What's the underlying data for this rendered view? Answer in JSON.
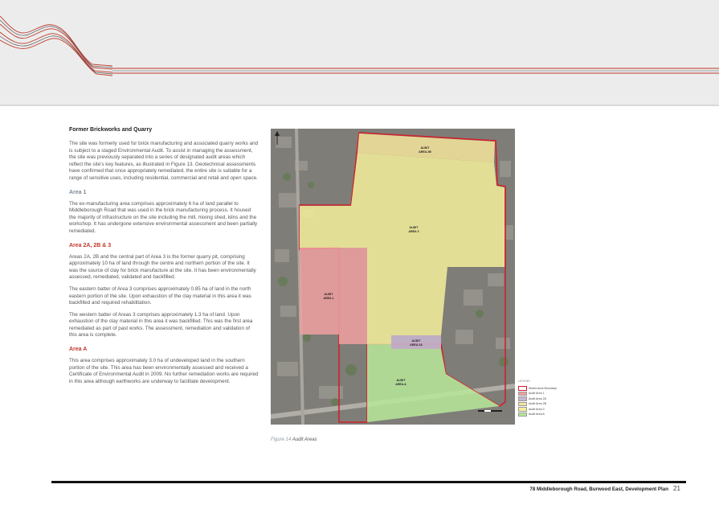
{
  "main": {
    "title": "Former Brickworks and Quarry",
    "intro": "The site was formerly used for brick manufacturing and associated quarry works and is subject to a staged Environmental Audit. To assist in managing the assessment, the site was previously separated into a series of designated audit areas which reflect the site's key features, as illustrated in Figure 13.  Geotechnical assessments have confirmed that once appropriately remediated, the entire site is suitable for a range of sensitive uses, including residential, commercial and retail and open space.",
    "area1_heading": "Area 1",
    "area1_text": "The ex-manufacturing area comprises approximately 6 ha of land parallel to Middleborough Road that was used in the brick manufacturing process.  It housed the majority of infrastructure on the site including the mill, mixing shed, kilns and the workshop. It has undergone extensive environmental assessment and been partially remediated.",
    "area2_heading": "Area 2A, 2B & 3",
    "area2_text1": "Areas 2A, 2B and the central part of Area 3 is the former quarry pit, comprising approximately 10 ha of land through the centre and northern portion of the site.  It was the source of clay for brick manufacture at the site.  It has been environmentally assessed, remediated, validated and backfilled.",
    "area2_text2": "The eastern batter of Area 3 comprises approximately 0.85 ha of land in the north eastern portion of the site. Upon exhaustion of the clay material in this area it was backfilled and required rehabilitation.",
    "area2_text3": "The western batter of Areas 3 comprises approximately 1.3 ha of land.  Upon exhaustion of the clay material in this area it was backfilled.  This was the first area remediated as part of past works.  The assessment, remediation and validation of this area is complete.",
    "areaA_heading": "Area A",
    "areaA_text": "This area comprises approximately 3.0 ha of undeveloped land in the southern portion of the site. This area has been environmentally assessed and received a Certificate of Environmental Audit in 2009.  No further remediation works are required in this area although earthworks are underway to facilitate development."
  },
  "map": {
    "labels": {
      "area2b": [
        "AUDIT",
        "AREA 2B"
      ],
      "area3": [
        "AUDIT",
        "AREA 3"
      ],
      "area1": [
        "AUDIT",
        "AREA 1"
      ],
      "area2a": [
        "AUDIT",
        "AREA 2A"
      ],
      "areaA": [
        "AUDIT",
        "AREA A"
      ]
    },
    "legend": {
      "title": "LEGEND",
      "items": [
        {
          "label": "Works Area Boundary",
          "color": "#ffffff",
          "border": "#d0202a"
        },
        {
          "label": "Audit Area 1",
          "color": "#f0a0a0",
          "border": "#999999"
        },
        {
          "label": "Audit Area 2A",
          "color": "#c8b4cc",
          "border": "#999999"
        },
        {
          "label": "Audit Area 2B",
          "color": "#f4e49a",
          "border": "#999999"
        },
        {
          "label": "Audit Area 3",
          "color": "#f4ee9a",
          "border": "#999999"
        },
        {
          "label": "Audit Area A",
          "color": "#b8e89a",
          "border": "#999999"
        }
      ]
    }
  },
  "caption": {
    "figure": "Figure 14",
    "title": "Audit Areas"
  },
  "footer": {
    "title": "78 Middleborough Road, Burwood East, Development Plan",
    "page": "21"
  }
}
